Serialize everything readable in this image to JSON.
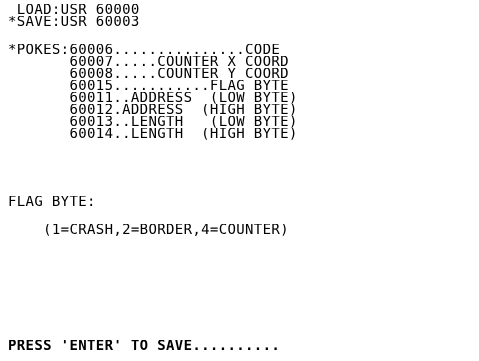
{
  "screen": {
    "background_color": "#ffffff",
    "text_color": "#000000",
    "lines": [
      " LOAD:USR 60000",
      "*SAVE:USR 60003",
      "",
      "*POKES:60006...............CODE",
      "       60007.....COUNTER X COORD",
      "       60008.....COUNTER Y COORD",
      "       60015...........FLAG BYTE",
      "       60011..ADDRESS  (LOW BYTE)",
      "       60012.ADDRESS  (HIGH BYTE)",
      "       60013..LENGTH   (LOW BYTE)",
      "       60014..LENGTH  (HIGH BYTE)",
      "FLAG BYTE:",
      "    (1=CRASH,2=BORDER,4=COUNTER)",
      "PRESS 'ENTER' TO SAVE.........."
    ]
  }
}
